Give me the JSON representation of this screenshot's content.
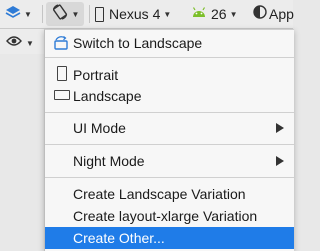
{
  "toolbar": {
    "device_name": "Nexus 4",
    "api_level": "26",
    "theme_label": "App"
  },
  "menu": {
    "switch_label": "Switch to Landscape",
    "portrait_label": "Portrait",
    "landscape_label": "Landscape",
    "ui_mode_label": "UI Mode",
    "night_mode_label": "Night Mode",
    "create_landscape_label": "Create Landscape Variation",
    "create_xlarge_label": "Create layout-xlarge Variation",
    "create_other_label": "Create Other...",
    "selected_color": "#1f7ce8"
  },
  "icons": {
    "layers": "layers-icon",
    "rotate": "rotate-icon",
    "device": "phone-icon",
    "android": "android-icon",
    "theme": "theme-icon",
    "eye": "eye-icon"
  }
}
